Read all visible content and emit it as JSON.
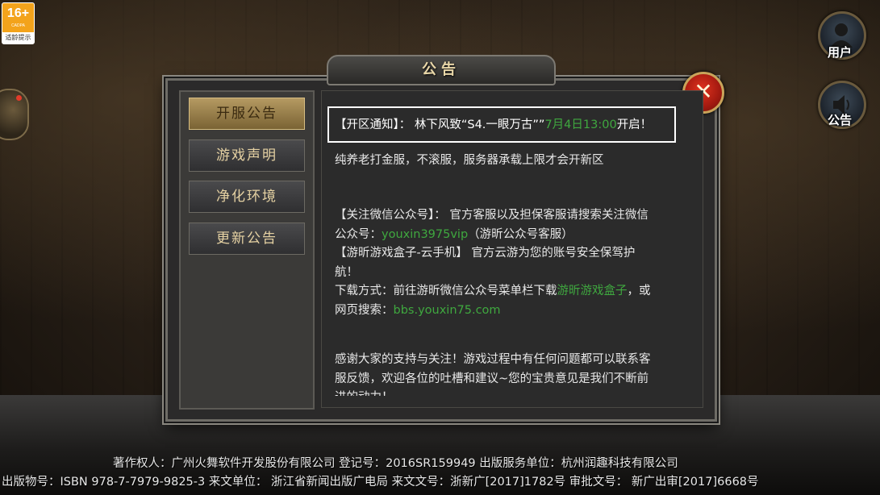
{
  "age_badge": {
    "rating": "16+",
    "org": "CADPA",
    "warning": "适龄提示"
  },
  "side_buttons": {
    "user_label": "用户",
    "notice_label": "公告"
  },
  "dialog": {
    "title": "公告",
    "close_glyph": "✕",
    "tabs": [
      {
        "label": "开服公告",
        "active": true
      },
      {
        "label": "游戏声明",
        "active": false
      },
      {
        "label": "净化环境",
        "active": false
      },
      {
        "label": "更新公告",
        "active": false
      }
    ],
    "notice": {
      "prefix": "【开区通知】：  林下风致“S4.一眼万古””",
      "time": "7月4日13:00",
      "suffix": "开启！"
    },
    "line_server": "纯养老打金服，不滚服，服务器承载上限才会开新区",
    "wechat": {
      "line1": "【关注微信公众号】：  官方客服以及担保客服请搜索关注微信",
      "line2_prefix": "公众号：",
      "account": "youxin3975vip",
      "line2_suffix": "（游昕公众号客服）"
    },
    "cloud": {
      "line1": "【游昕游戏盒子-云手机】  官方云游为您的账号安全保驾护",
      "line2": "航！"
    },
    "download": {
      "line1_prefix": "下载方式：前往游昕微信公众号菜单栏下载",
      "box_name": "游昕游戏盒子",
      "line1_suffix": "，或",
      "line2_prefix": "网页搜索：",
      "site": "bbs.youxin75.com"
    },
    "thanks": {
      "line1": "感谢大家的支持与关注！游戏过程中有任何问题都可以联系客",
      "line2": "服反馈，欢迎各位的吐槽和建议~您的宝贵意见是我们不断前",
      "line3": "进的动力！"
    }
  },
  "copyright": {
    "row1": "著作权人：广州火舞软件开发股份有限公司    登记号：2016SR159949    出版服务单位：杭州润趣科技有限公司",
    "row2": "出版物号：ISBN 978-7-7979-9825-3    来文单位：  浙江省新闻出版广电局    来文文号：浙新广[2017]1782号    审批文号：  新广出审[2017]6668号"
  },
  "colors": {
    "accent_green": "#3fa83f",
    "title_gold": "#e9d7a8",
    "close_red": "#d42a18"
  },
  "icons": [
    "user-icon",
    "speaker-icon",
    "close-icon",
    "side-event-icon"
  ]
}
